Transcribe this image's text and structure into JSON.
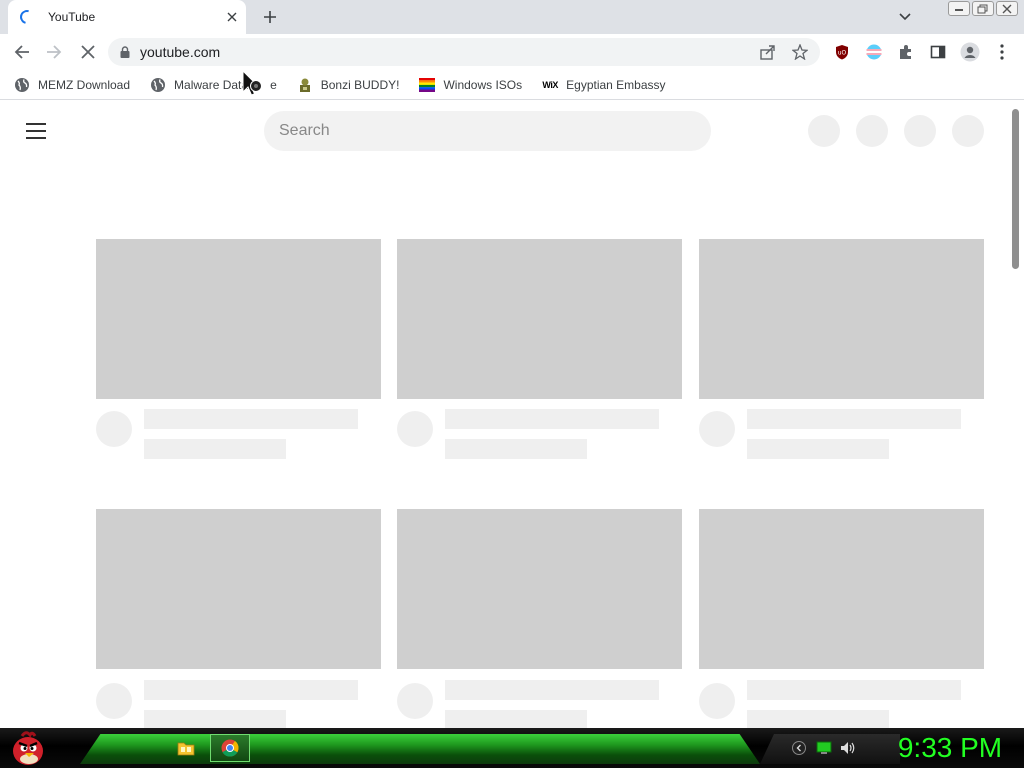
{
  "browser": {
    "tab": {
      "title": "YouTube"
    },
    "address": {
      "url": "youtube.com"
    },
    "bookmarks": [
      {
        "label": "MEMZ Download",
        "icon": "globe-icon"
      },
      {
        "label": "Malware Data",
        "suffix": "e",
        "icon": "globe-icon"
      },
      {
        "label": "Bonzi BUDDY!",
        "icon": "bonzi-icon"
      },
      {
        "label": "Windows ISOs",
        "icon": "rainbow-flag-icon"
      },
      {
        "label": "Egyptian Embassy",
        "icon": "wix-icon",
        "icon_text": "WiX"
      }
    ],
    "extensions": [
      "ublock-icon",
      "trans-flag-icon",
      "puzzle-icon",
      "side-panel-icon",
      "profile-icon",
      "more-icon"
    ]
  },
  "page": {
    "search": {
      "placeholder": "Search"
    }
  },
  "taskbar": {
    "clock": "9:33 PM",
    "accent_color": "#22ff22"
  },
  "colors": {
    "skeleton_thumb": "#cfcfcf",
    "skeleton_light": "#efefef",
    "tabstrip": "#dee1e6"
  }
}
